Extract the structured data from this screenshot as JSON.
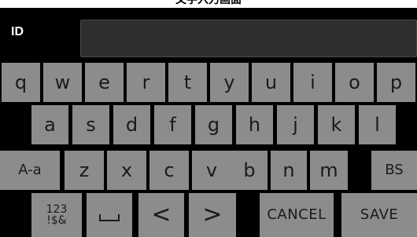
{
  "title": "文字入力画面",
  "field": {
    "label": "ID",
    "value": ""
  },
  "keyboard": {
    "row1": [
      "q",
      "w",
      "e",
      "r",
      "t",
      "y",
      "u",
      "i",
      "o",
      "p"
    ],
    "row2": [
      "a",
      "s",
      "d",
      "f",
      "g",
      "h",
      "j",
      "k",
      "l"
    ],
    "row3": {
      "case_label": "A-a",
      "letters": [
        "z",
        "x",
        "c",
        "v",
        "b",
        "n",
        "m"
      ],
      "backspace_label": "BS"
    },
    "row4": {
      "symbols_line1": "123",
      "symbols_line2": "!$&",
      "space_icon": "space-bar-icon",
      "left_label": "<",
      "right_label": ">",
      "cancel_label": "CANCEL",
      "save_label": "SAVE"
    }
  },
  "colors": {
    "background": "#000000",
    "key": "#8c8c8c",
    "key_text": "#1a1a1a",
    "field": "#2e2e2e"
  }
}
